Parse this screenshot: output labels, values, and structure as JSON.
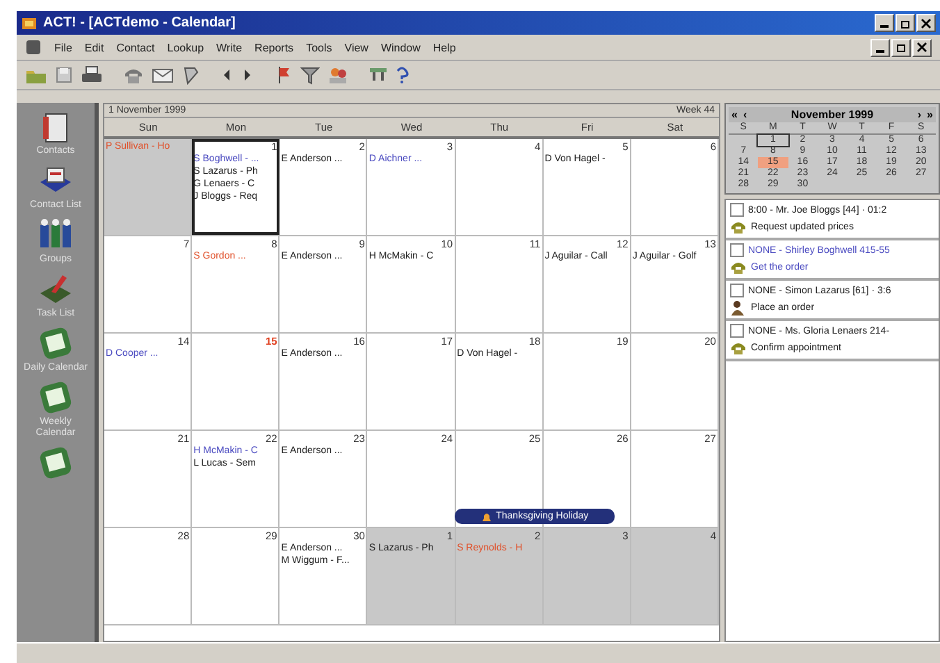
{
  "window": {
    "title": "ACT! - [ACTdemo - Calendar]"
  },
  "menu": [
    "File",
    "Edit",
    "Contact",
    "Lookup",
    "Write",
    "Reports",
    "Tools",
    "View",
    "Window",
    "Help"
  ],
  "sidebar": [
    {
      "label": "Contacts",
      "kind": "card"
    },
    {
      "label": "Contact List",
      "kind": "list"
    },
    {
      "label": "Groups",
      "kind": "group"
    },
    {
      "label": "Task List",
      "kind": "task"
    },
    {
      "label": "Daily Calendar",
      "kind": "calendar"
    },
    {
      "label": "Weekly Calendar",
      "kind": "calendar"
    },
    {
      "kind": "calendar"
    }
  ],
  "calendar": {
    "title": "1 November 1999",
    "week": "Week 44",
    "days": [
      "Sun",
      "Mon",
      "Tue",
      "Wed",
      "Thu",
      "Fri",
      "Sat"
    ],
    "weeks": [
      {
        "cells": [
          {
            "dimmed": true,
            "selected": false,
            "events": [
              {
                "text": "P Sullivan - Ho",
                "color": "#e0502a"
              }
            ]
          },
          {
            "day": "1",
            "dimmed": false,
            "selected": true,
            "today": false,
            "events": [
              {
                "text": "S Boghwell - ...",
                "color": "#4a4ac0"
              },
              {
                "text": "S Lazarus - Ph",
                "color": "#202020"
              },
              {
                "text": "G Lenaers - C",
                "color": "#202020"
              },
              {
                "text": "J Bloggs - Req",
                "color": "#202020"
              }
            ]
          },
          {
            "day": "2",
            "dimmed": false,
            "selected": false,
            "today": false,
            "events": [
              {
                "text": "E Anderson ...",
                "color": "#202020"
              }
            ]
          },
          {
            "day": "3",
            "dimmed": false,
            "selected": false,
            "today": false,
            "events": [
              {
                "text": "D Aichner ...",
                "color": "#4a4ac0"
              }
            ]
          },
          {
            "day": "4",
            "dimmed": false,
            "selected": false,
            "today": false
          },
          {
            "day": "5",
            "dimmed": false,
            "selected": false,
            "today": false,
            "events": [
              {
                "text": "D Von Hagel -",
                "color": "#202020"
              }
            ]
          },
          {
            "day": "6",
            "dimmed": false,
            "selected": false,
            "today": false
          }
        ]
      },
      {
        "cells": [
          {
            "day": "7",
            "dimmed": false,
            "selected": false,
            "today": false
          },
          {
            "day": "8",
            "dimmed": false,
            "selected": false,
            "today": false,
            "events": [
              {
                "text": "S Gordon ...",
                "color": "#e0502a"
              }
            ]
          },
          {
            "day": "9",
            "dimmed": false,
            "selected": false,
            "today": false,
            "events": [
              {
                "text": "E Anderson ...",
                "color": "#202020"
              }
            ]
          },
          {
            "day": "10",
            "dimmed": false,
            "selected": false,
            "today": false,
            "events": [
              {
                "text": "H McMakin - C",
                "color": "#202020"
              }
            ]
          },
          {
            "day": "11",
            "dimmed": false,
            "selected": false,
            "today": false
          },
          {
            "day": "12",
            "dimmed": false,
            "selected": false,
            "today": false,
            "events": [
              {
                "text": "J Aguilar - Call",
                "color": "#202020"
              }
            ]
          },
          {
            "day": "13",
            "dimmed": false,
            "selected": false,
            "today": false,
            "events": [
              {
                "text": "J Aguilar - Golf",
                "color": "#202020"
              }
            ]
          }
        ]
      },
      {
        "cells": [
          {
            "day": "14",
            "dimmed": false,
            "selected": false,
            "today": false,
            "events": [
              {
                "text": "D Cooper ...",
                "color": "#4a4ac0"
              }
            ]
          },
          {
            "day": "15",
            "dimmed": false,
            "selected": false,
            "today": true
          },
          {
            "day": "16",
            "dimmed": false,
            "selected": false,
            "today": false,
            "events": [
              {
                "text": "E Anderson ...",
                "color": "#202020"
              }
            ]
          },
          {
            "day": "17",
            "dimmed": false,
            "selected": false,
            "today": false
          },
          {
            "day": "18",
            "dimmed": false,
            "selected": false,
            "today": false,
            "events": [
              {
                "text": "D Von Hagel -",
                "color": "#202020"
              }
            ]
          },
          {
            "day": "19",
            "dimmed": false,
            "selected": false,
            "today": false
          },
          {
            "day": "20",
            "dimmed": false,
            "selected": false,
            "today": false
          }
        ]
      },
      {
        "banner": "Thanksgiving Holiday",
        "cells": [
          {
            "day": "21",
            "dimmed": false,
            "selected": false,
            "today": false
          },
          {
            "day": "22",
            "dimmed": false,
            "selected": false,
            "today": false,
            "events": [
              {
                "text": "H McMakin - C",
                "color": "#4a4ac0"
              },
              {
                "text": "L Lucas - Sem",
                "color": "#202020"
              }
            ]
          },
          {
            "day": "23",
            "dimmed": false,
            "selected": false,
            "today": false,
            "events": [
              {
                "text": "E Anderson ...",
                "color": "#202020"
              }
            ]
          },
          {
            "day": "24",
            "dimmed": false,
            "selected": false,
            "today": false
          },
          {
            "day": "25",
            "dimmed": false,
            "selected": false,
            "today": false
          },
          {
            "day": "26",
            "dimmed": false,
            "selected": false,
            "today": false
          },
          {
            "day": "27",
            "dimmed": false,
            "selected": false,
            "today": false
          }
        ]
      },
      {
        "cells": [
          {
            "day": "28",
            "dimmed": false,
            "selected": false,
            "today": false
          },
          {
            "day": "29",
            "dimmed": false,
            "selected": false,
            "today": false
          },
          {
            "day": "30",
            "dimmed": false,
            "selected": false,
            "today": false,
            "events": [
              {
                "text": "E Anderson ...",
                "color": "#202020"
              },
              {
                "text": "M Wiggum - F...",
                "color": "#202020"
              }
            ]
          },
          {
            "day": "1",
            "dimmed": true,
            "selected": false,
            "today": false,
            "events": [
              {
                "text": "S Lazarus - Ph",
                "color": "#202020"
              }
            ]
          },
          {
            "day": "2",
            "dimmed": true,
            "selected": false,
            "today": false,
            "events": [
              {
                "text": "S Reynolds - H",
                "color": "#e0502a"
              }
            ]
          },
          {
            "day": "3",
            "dimmed": true,
            "selected": false,
            "today": false
          },
          {
            "day": "4",
            "dimmed": true,
            "selected": false,
            "today": false
          }
        ]
      }
    ]
  },
  "mini_calendar": {
    "title": "November 1999",
    "nav": [
      "«",
      "‹",
      "›",
      "»"
    ],
    "days": [
      "S",
      "M",
      "T",
      "W",
      "T",
      "F",
      "S"
    ],
    "weeks": [
      [
        {
          "day": "1",
          "selected": true,
          "today": false
        },
        {
          "day": "2",
          "selected": false,
          "today": false
        },
        {
          "day": "3",
          "selected": false,
          "today": false
        },
        {
          "day": "4",
          "selected": false,
          "today": false
        },
        {
          "day": "5",
          "selected": false,
          "today": false
        },
        {
          "day": "6",
          "selected": false,
          "today": false
        }
      ],
      [
        {
          "day": "7",
          "selected": false,
          "today": false
        },
        {
          "day": "8",
          "selected": false,
          "today": false
        },
        {
          "day": "9",
          "selected": false,
          "today": false
        },
        {
          "day": "10",
          "selected": false,
          "today": false
        },
        {
          "day": "11",
          "selected": false,
          "today": false
        },
        {
          "day": "12",
          "selected": false,
          "today": false
        },
        {
          "day": "13",
          "selected": false,
          "today": false
        }
      ],
      [
        {
          "day": "14",
          "selected": false,
          "today": false
        },
        {
          "day": "15",
          "selected": false,
          "today": true
        },
        {
          "day": "16",
          "selected": false,
          "today": false
        },
        {
          "day": "17",
          "selected": false,
          "today": false
        },
        {
          "day": "18",
          "selected": false,
          "today": false
        },
        {
          "day": "19",
          "selected": false,
          "today": false
        },
        {
          "day": "20",
          "selected": false,
          "today": false
        }
      ],
      [
        {
          "day": "21",
          "selected": false,
          "today": false
        },
        {
          "day": "22",
          "selected": false,
          "today": false
        },
        {
          "day": "23",
          "selected": false,
          "today": false
        },
        {
          "day": "24",
          "selected": false,
          "today": false
        },
        {
          "day": "25",
          "selected": false,
          "today": false
        },
        {
          "day": "26",
          "selected": false,
          "today": false
        },
        {
          "day": "27",
          "selected": false,
          "today": false
        }
      ],
      [
        {
          "day": "28",
          "selected": false,
          "today": false
        },
        {
          "day": "29",
          "selected": false,
          "today": false
        },
        {
          "day": "30",
          "selected": false,
          "today": false
        }
      ]
    ]
  },
  "tasks": [
    {
      "checked": false,
      "heading": "8:00 - Mr. Joe Bloggs [44] · 01:2",
      "action": "Request updated prices",
      "kind": "call",
      "color": "#202020"
    },
    {
      "checked": false,
      "heading": "NONE - Shirley Boghwell 415-55",
      "action": "Get the order",
      "kind": "call",
      "color": "#4a4ac0"
    },
    {
      "checked": false,
      "heading": "NONE - Simon Lazarus [61] · 3:6",
      "action": "Place an order",
      "kind": "todo",
      "color": "#202020"
    },
    {
      "checked": false,
      "heading": "NONE - Ms. Gloria Lenaers 214-",
      "action": "Confirm appointment",
      "kind": "call",
      "color": "#202020"
    }
  ]
}
